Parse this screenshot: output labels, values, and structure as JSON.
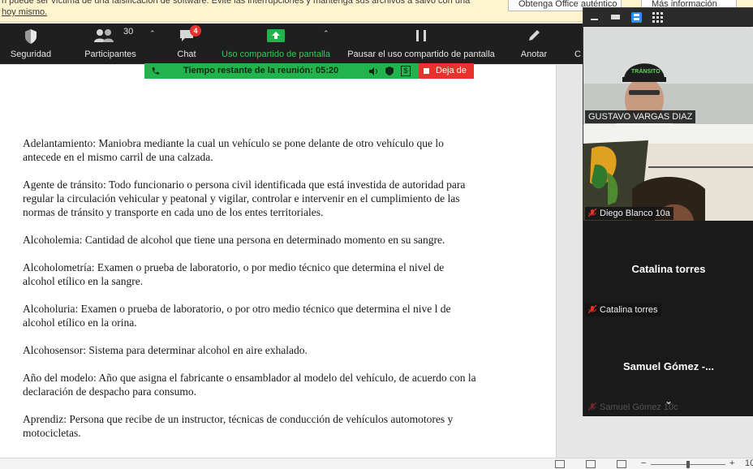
{
  "notice": {
    "line1": "n puede ser víctima de una falsificación de software. Evite las interrupciones y mantenga sus archivos a salvo con una",
    "line2": "hoy mismo.",
    "btn_office": "Obtenga Office auténtico",
    "btn_info": "Más información"
  },
  "toolbar": {
    "security": "Seguridad",
    "participants": "Participantes",
    "participants_count": "30",
    "chat": "Chat",
    "chat_badge": "4",
    "share": "Uso compartido de pantalla",
    "pause": "Pausar el uso compartido de pantalla",
    "annotate": "Anotar",
    "more": "C"
  },
  "meeting": {
    "timer": "Tiempo restante de la reunión: 05:20",
    "stop": "Deja de"
  },
  "document": {
    "paragraphs": [
      "Adelantamiento: Maniobra mediante la cual un vehículo se pone delante de otro vehículo que lo antecede en el mismo carril de una calzada.",
      "Agente de tránsito: Todo funcionario o persona civil identificada que está investida de autoridad para regular la circulación vehicular y peatonal y vigilar, controlar e intervenir en el cumplimiento de las normas de tránsito y transporte en cada uno de los entes territoriales.",
      "Alcoholemia: Cantidad de alcohol que tiene una persona en determinado momento en su sangre.",
      "Alcoholometría: Examen o prueba de laboratorio, o por medio técnico que determina el nivel de alcohol etílico en la sangre.",
      "Alcoholuria: Examen o prueba de laboratorio, o por otro medio técnico que determina el nive l de alcohol etílico en la orina.",
      "Alcohosensor: Sistema para determinar alcohol en aire exhalado.",
      "Año del modelo: Año que asigna el fabricante o ensamblador al modelo del vehículo, de acuerdo con la declaración de despacho para consumo.",
      "Aprendiz: Persona que recibe de un instructor, técnicas de conducción de vehículos automotores y motocicletas."
    ]
  },
  "participants": [
    {
      "name": "GUSTAVO VARGAS DIAZ"
    },
    {
      "name": "Diego Blanco 10a"
    },
    {
      "name": "Catalina torres",
      "display": "Catalina torres"
    },
    {
      "name": "Samuel Gómez 10c",
      "display": "Samuel Gómez -..."
    }
  ],
  "cap_text": "TRÁNSITO",
  "statusbar": {
    "zoom_minus": "−",
    "zoom_plus": "+",
    "zoom_pct": "10"
  },
  "colors": {
    "accent_green": "#23b34d",
    "record_red": "#e8322b",
    "toolbar_bg": "#1f1f1f",
    "notice_bg": "#fff4ce"
  }
}
